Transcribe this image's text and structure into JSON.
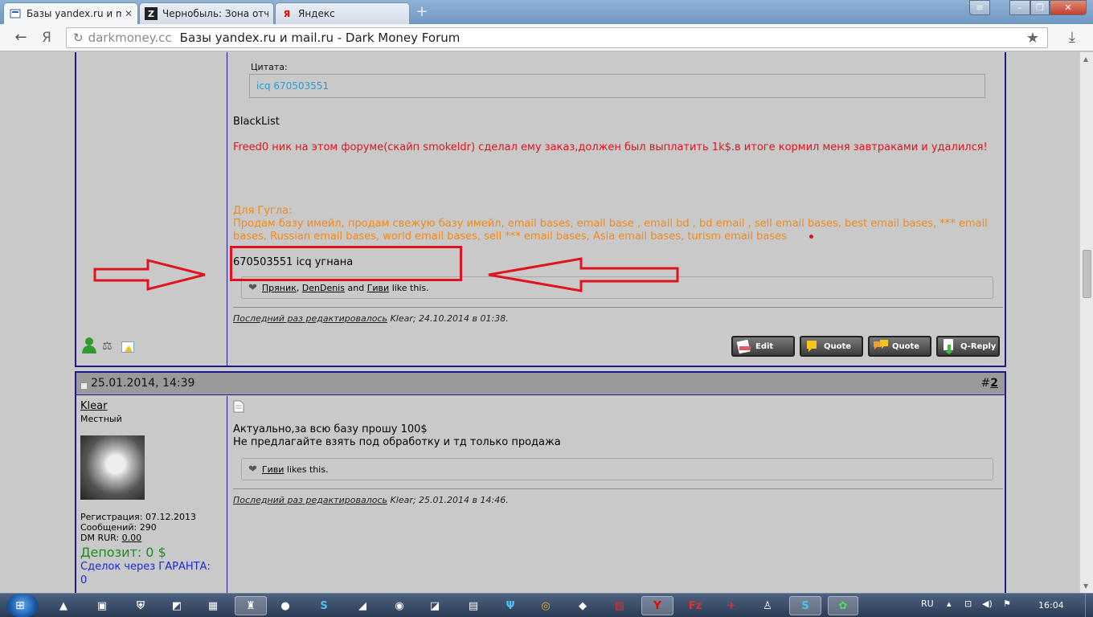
{
  "browser": {
    "tabs": [
      {
        "title": "Базы yandex.ru и mail",
        "favicon": "forum-icon",
        "active": true
      },
      {
        "title": "Чернобыль: Зона отч",
        "favicon": "Z",
        "active": false
      },
      {
        "title": "Яндекс",
        "favicon": "Я",
        "active": false
      }
    ],
    "new_tab": "+",
    "yandex_button": "Я",
    "address_domain": "darkmoney.cc",
    "address_title": "Базы yandex.ru и mail.ru - Dark Money Forum"
  },
  "post1": {
    "quote_label": "Цитата:",
    "quote_text": "icq 670503551",
    "blacklist": "BlackList",
    "red_text": "Freed0 ник на этом форуме(скайп smokeldr) сделал ему заказ,должен был выплатить 1k$.в итоге кормил меня завтраками и удалился!",
    "google_label": "Для Гугла:",
    "google_text_1": "Продам базу имейл, продам свежую базу имейл, email bases, email base , email bd , bd email , sell email bases, best email bases, *** email",
    "google_text_2": "bases, Russian email bases, world email bases, sell *** email bases, Asia email bases, turism email bases",
    "icq_stolen": "670503551 icq угнана",
    "likes": {
      "user1": "Пряник",
      "sep1": ",",
      "user2": "DenDenis",
      "and": "and",
      "user3": "Гиви",
      "suffix": "like this."
    },
    "edited": {
      "prefix": "Последний раз редактировалось",
      "user": "Klear",
      "rest": "; 24.10.2014 в 01:38."
    },
    "buttons": {
      "edit": "Edit",
      "quote": "Quote",
      "multiquote": "Quote",
      "qreply": "Q-Reply"
    }
  },
  "post2": {
    "date": "25.01.2014, 14:39",
    "number_hash": "#",
    "number": "2",
    "user": {
      "name": "Klear",
      "rank": "Местный",
      "registration": "Регистрация: 07.12.2013",
      "messages": "Сообщений: 290",
      "dm_label": "DM RUR:",
      "dm_value": "0.00",
      "deposit": "Депозит: 0 $",
      "garant_label": "Сделок через ГАРАНТА:",
      "garant_value": "0"
    },
    "line1": "Актуально,за всю базу прошу 100$",
    "line2": "Не предлагайте взять под обработку и тд только продажа",
    "likes": {
      "user": "Гиви",
      "suffix": "likes this."
    },
    "edited": {
      "prefix": "Последний раз редактировалось",
      "user": "Klear",
      "rest": "; 25.01.2014 в 14:46."
    }
  },
  "taskbar": {
    "lang": "RU",
    "time": "16:04"
  },
  "colors": {
    "post_border": "#1a1a8a",
    "red_text": "#e0141e",
    "orange_text": "#f28a1a",
    "quote_text": "#2a9bd6",
    "deposit_green": "#1e8a1e",
    "garant_blue": "#1a2ad6"
  }
}
